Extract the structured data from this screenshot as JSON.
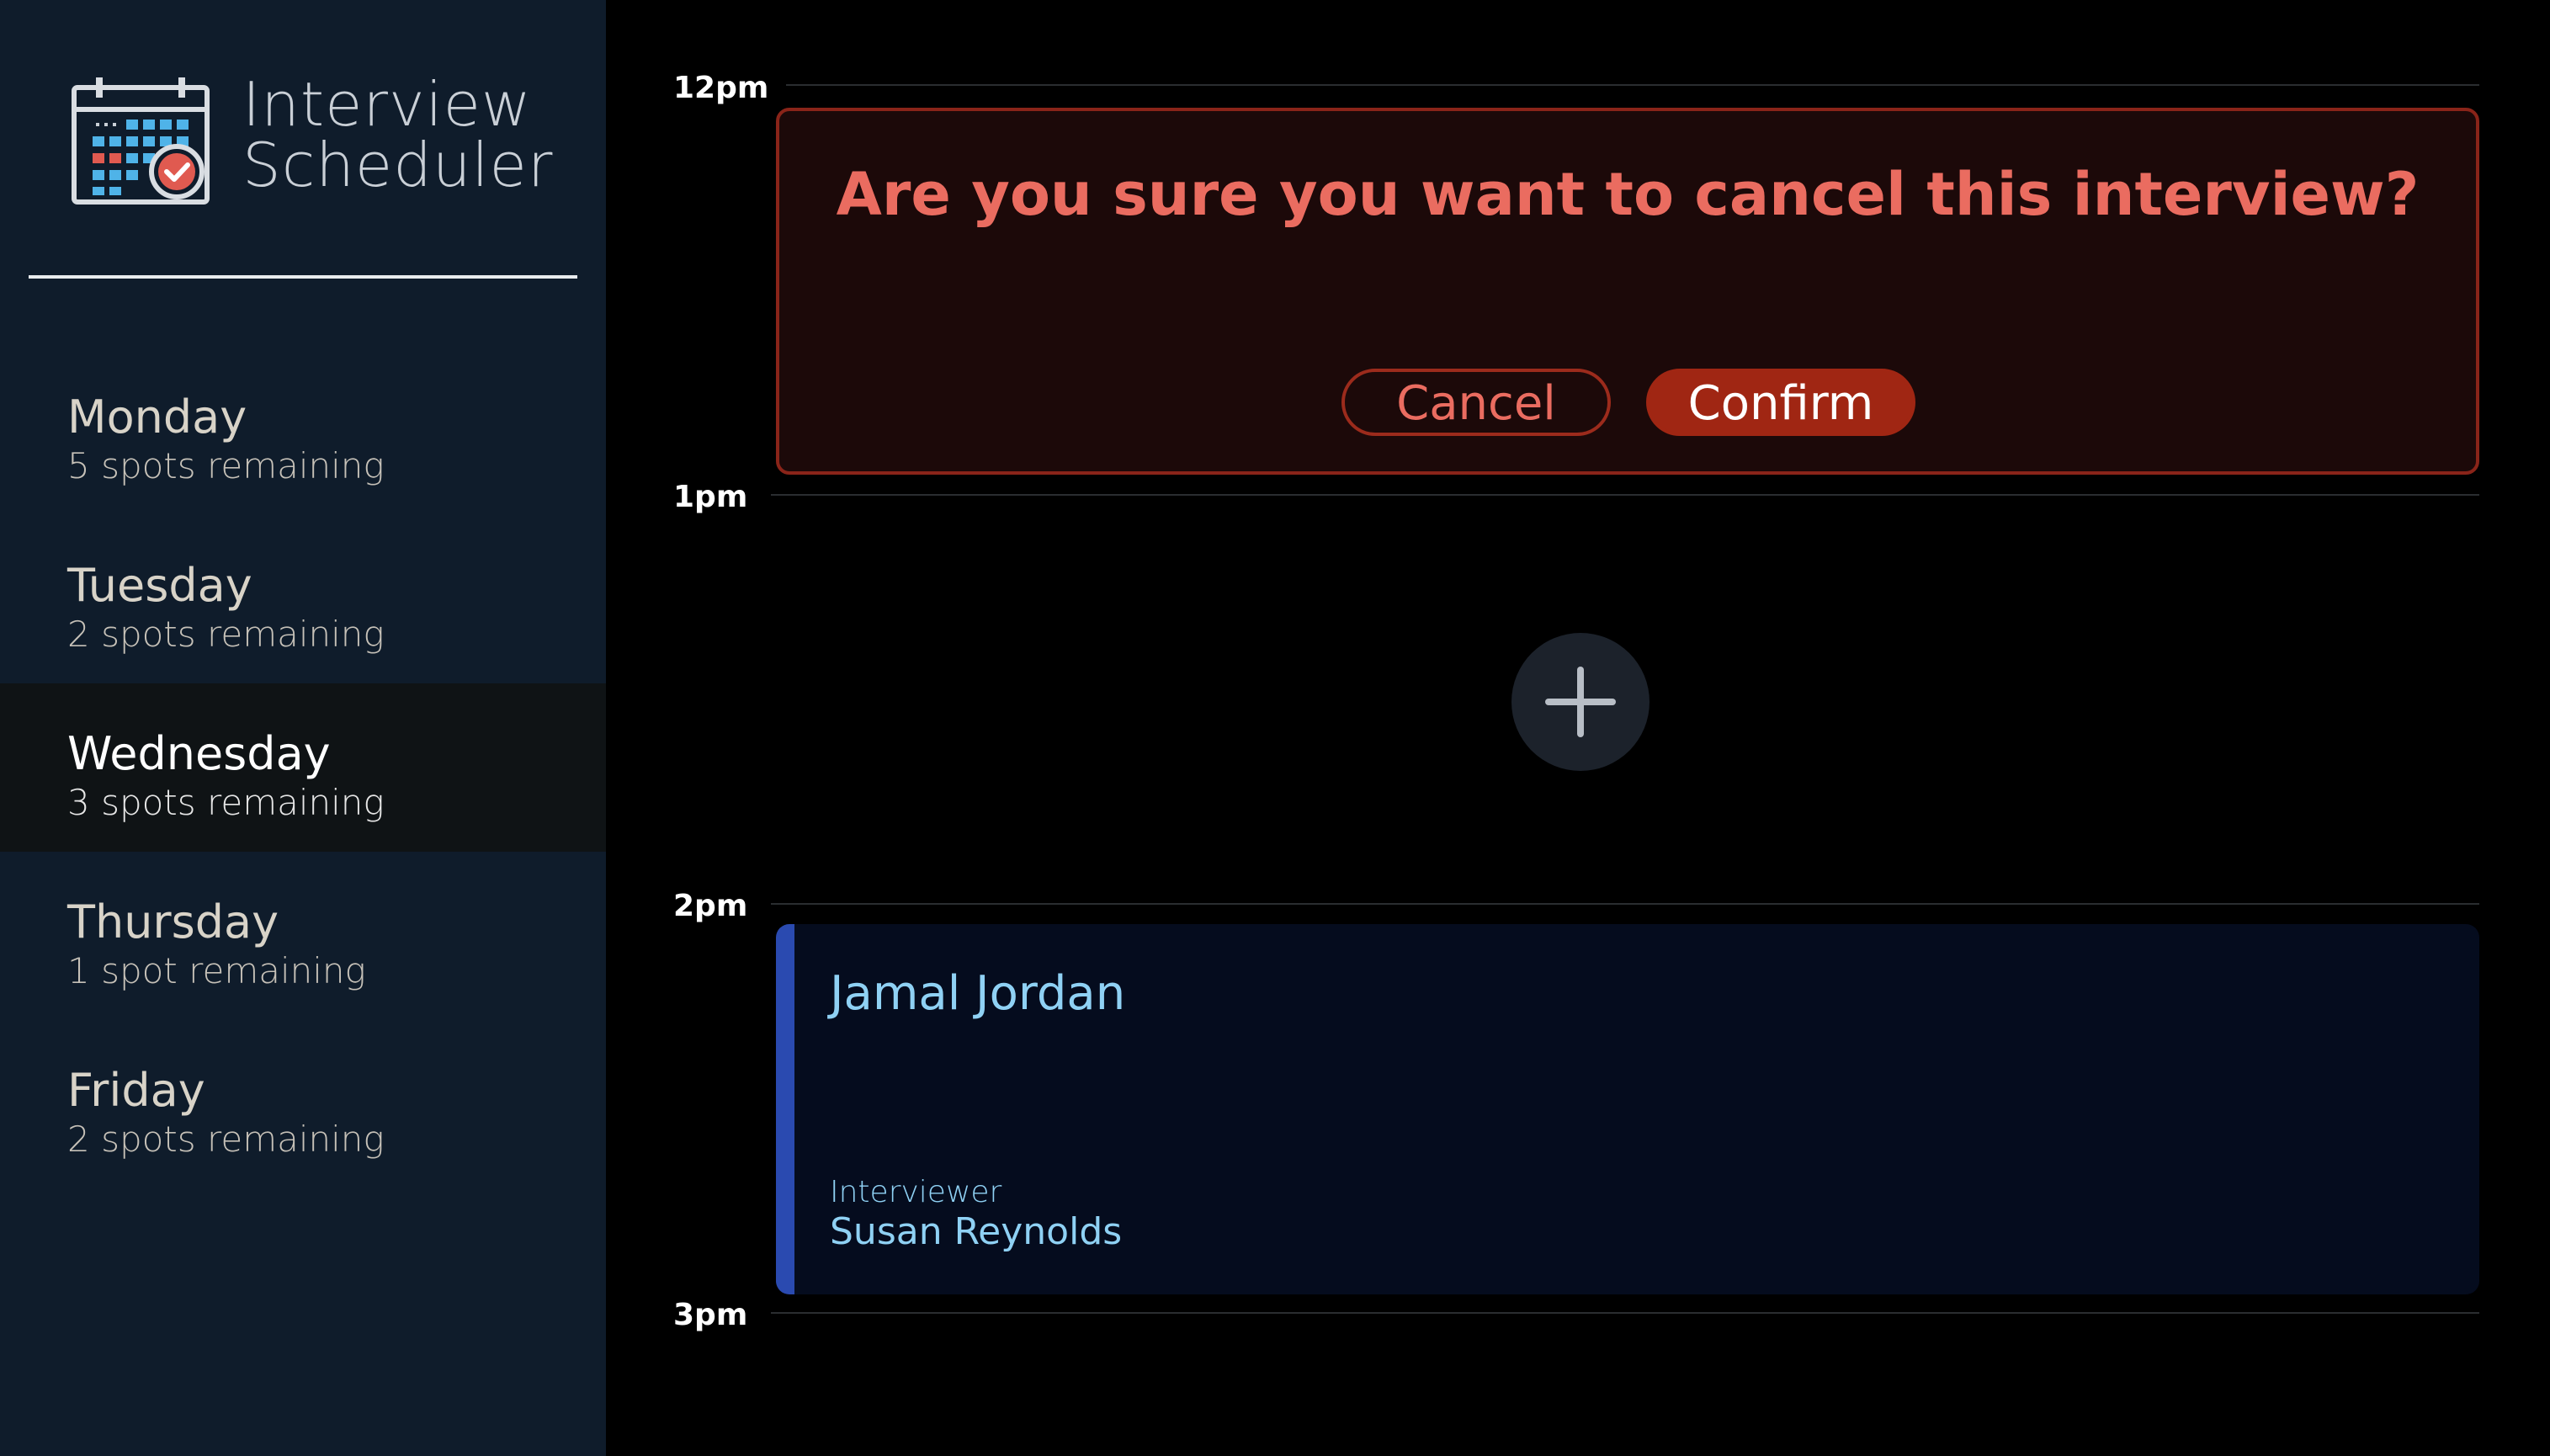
{
  "app": {
    "title_line1": "Interview",
    "title_line2": "Scheduler"
  },
  "sidebar": {
    "days": [
      {
        "name": "Monday",
        "spots": "5 spots remaining"
      },
      {
        "name": "Tuesday",
        "spots": "2 spots remaining"
      },
      {
        "name": "Wednesday",
        "spots": "3 spots remaining",
        "selected": true
      },
      {
        "name": "Thursday",
        "spots": "1 spot remaining"
      },
      {
        "name": "Friday",
        "spots": "2 spots remaining"
      }
    ]
  },
  "schedule": {
    "hours": [
      "12pm",
      "1pm",
      "2pm",
      "3pm"
    ],
    "confirm": {
      "question": "Are you sure you want to cancel this interview?",
      "cancel_label": "Cancel",
      "confirm_label": "Confirm"
    },
    "add_icon": "plus-icon",
    "appointment": {
      "student": "Jamal Jordan",
      "interviewer_label": "Interviewer",
      "interviewer": "Susan Reynolds"
    }
  },
  "colors": {
    "sidebar_bg": "#0f1c2b",
    "selected_day_bg": "#0f1315",
    "danger": "#a02613",
    "danger_text": "#ea6c60",
    "appointment_text": "#8fd1f4",
    "appointment_accent": "#2a4ab0"
  }
}
